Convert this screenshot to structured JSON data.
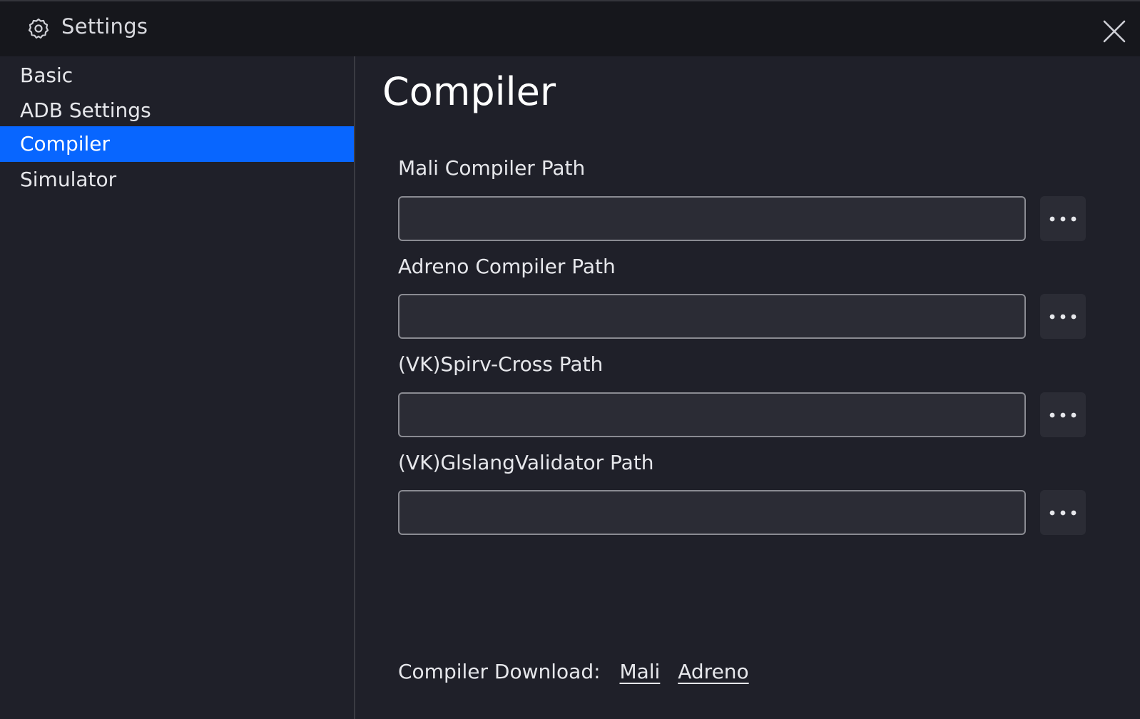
{
  "titlebar": {
    "title": "Settings",
    "icon": "gear-icon",
    "close_icon": "close-icon"
  },
  "sidebar": {
    "items": [
      {
        "label": "Basic",
        "active": false
      },
      {
        "label": "ADB Settings",
        "active": false
      },
      {
        "label": "Compiler",
        "active": true
      },
      {
        "label": "Simulator",
        "active": false
      }
    ]
  },
  "main": {
    "title": "Compiler",
    "fields": [
      {
        "label": "Mali Compiler Path",
        "value": "",
        "button": "more-icon"
      },
      {
        "label": "Adreno Compiler Path",
        "value": "",
        "button": "more-icon"
      },
      {
        "label": "(VK)Spirv-Cross Path",
        "value": "",
        "button": "more-icon"
      },
      {
        "label": "(VK)GlslangValidator Path",
        "value": "",
        "button": "more-icon"
      }
    ],
    "download": {
      "label": "Compiler Download:",
      "links": [
        "Mali",
        "Adreno"
      ]
    }
  },
  "colors": {
    "accent": "#0866ff",
    "background": "#1f2029",
    "titlebar": "#16171c",
    "input_bg": "#2b2c35"
  }
}
